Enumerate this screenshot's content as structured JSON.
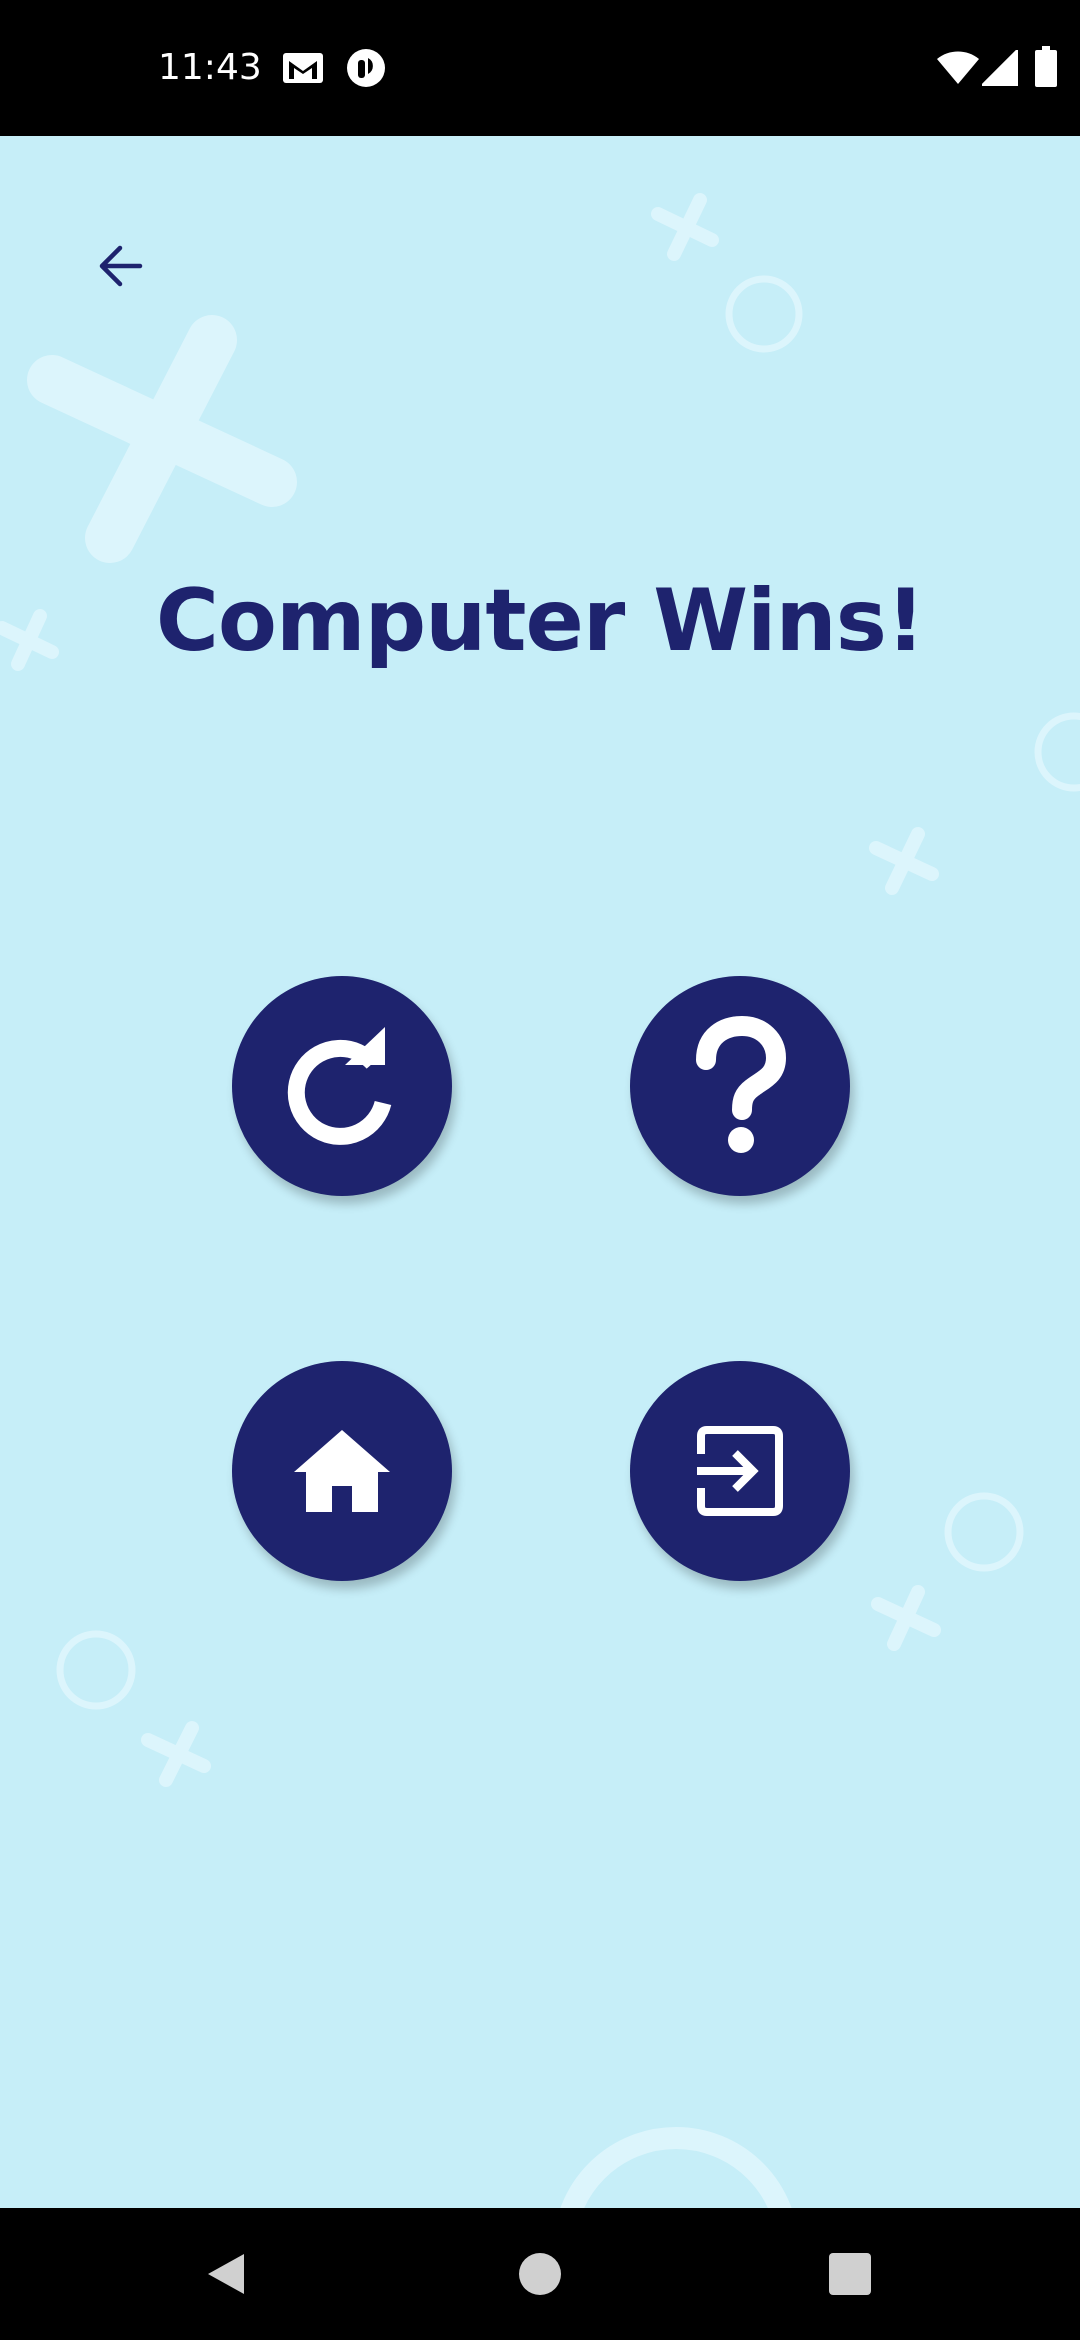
{
  "status_bar": {
    "time": "11:43",
    "left_icons": [
      "gmail-icon",
      "app-notification-icon"
    ],
    "right_icons": [
      "wifi-icon",
      "cell-signal-icon",
      "battery-icon"
    ]
  },
  "screen": {
    "title": "Computer Wins!",
    "back_icon": "arrow-left-icon",
    "buttons": [
      {
        "name": "restart-button",
        "icon": "redo-icon"
      },
      {
        "name": "help-button",
        "icon": "question-mark-icon"
      },
      {
        "name": "home-button",
        "icon": "home-icon"
      },
      {
        "name": "exit-button",
        "icon": "exit-icon"
      }
    ]
  },
  "navigation_bar": {
    "icons": [
      "nav-back-icon",
      "nav-home-icon",
      "nav-recents-icon"
    ]
  },
  "colors": {
    "background": "#c6eef8",
    "primary": "#1e236e",
    "decoration": "#dcf5fc",
    "bars": "#000000"
  }
}
